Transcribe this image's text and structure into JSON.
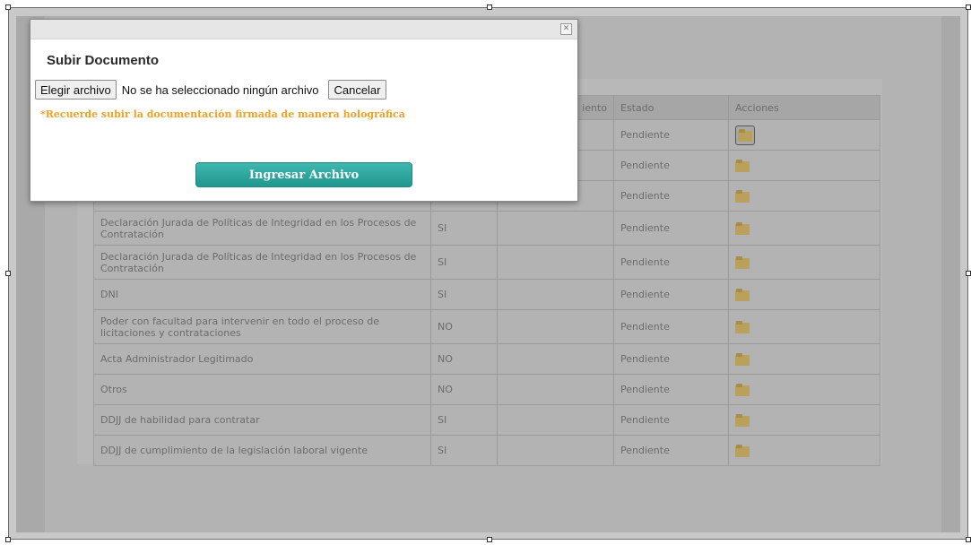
{
  "modal": {
    "title": "Subir Documento",
    "close_icon": "close-icon",
    "choose_file_label": "Elegir archivo",
    "file_status": "No se ha seleccionado ningún archivo",
    "cancel_label": "Cancelar",
    "notice": "*Recuerde subir la documentación firmada de manera holográfica",
    "submit_label": "Ingresar Archivo",
    "accent_color": "#2aa79e",
    "notice_color": "#f0a224"
  },
  "table": {
    "headers": [
      "",
      "",
      "iento",
      "Estado",
      "Acciones"
    ],
    "rows": [
      {
        "doc": "",
        "req": "",
        "venc": "",
        "estado": "Pendiente"
      },
      {
        "doc": "",
        "req": "",
        "venc": "",
        "estado": "Pendiente"
      },
      {
        "doc": "",
        "req": "",
        "venc": "",
        "estado": "Pendiente"
      },
      {
        "doc": "Declaración Jurada de Políticas de Integridad en los Procesos de Contratación",
        "req": "SI",
        "venc": "",
        "estado": "Pendiente"
      },
      {
        "doc": "Declaración Jurada de Políticas de Integridad en los Procesos de Contratación",
        "req": "SI",
        "venc": "",
        "estado": "Pendiente"
      },
      {
        "doc": "DNI",
        "req": "SI",
        "venc": "",
        "estado": "Pendiente"
      },
      {
        "doc": "Poder con facultad para intervenir en todo el proceso de licitaciones y contrataciones",
        "req": "NO",
        "venc": "",
        "estado": "Pendiente"
      },
      {
        "doc": "Acta Administrador Legitimado",
        "req": "NO",
        "venc": "",
        "estado": "Pendiente"
      },
      {
        "doc": "Otros",
        "req": "NO",
        "venc": "",
        "estado": "Pendiente"
      },
      {
        "doc": "DDJJ de habilidad para contratar",
        "req": "SI",
        "venc": "",
        "estado": "Pendiente"
      },
      {
        "doc": "DDJJ de cumplimiento de la legislación laboral vigente",
        "req": "SI",
        "venc": "",
        "estado": "Pendiente"
      }
    ],
    "action_icon": "folder-icon"
  }
}
